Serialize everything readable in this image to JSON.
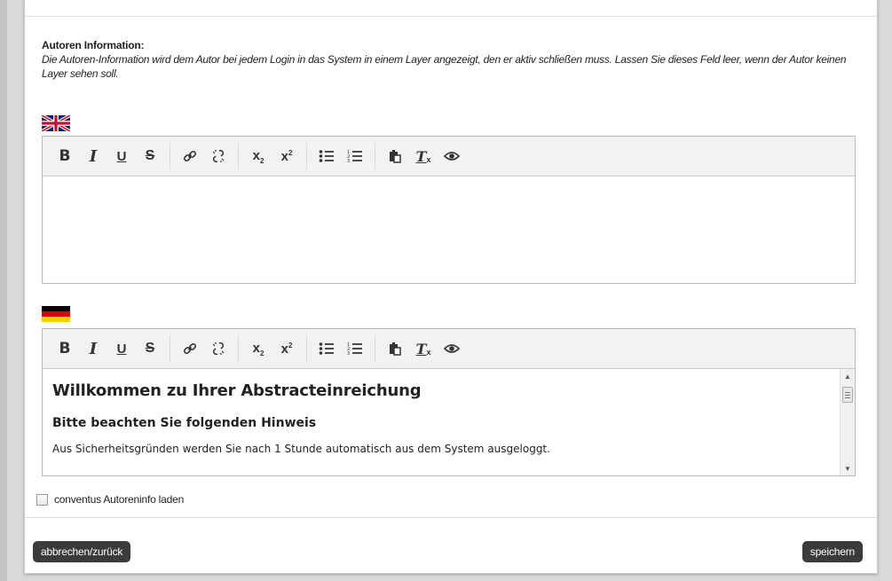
{
  "author_info": {
    "title": "Autoren Information:",
    "description": "Die Autoren-Information wird dem Autor bei jedem Login in das System in einem Layer angezeigt, den er aktiv schließen muss. Lassen Sie dieses Feld leer, wenn der Autor keinen Layer sehen soll."
  },
  "toolbar": {
    "buttons": [
      {
        "name": "bold",
        "icon": "bold-icon"
      },
      {
        "name": "italic",
        "icon": "italic-icon"
      },
      {
        "name": "underline",
        "icon": "underline-icon"
      },
      {
        "name": "strikethrough",
        "icon": "strikethrough-icon"
      },
      {
        "name": "link",
        "icon": "link-icon"
      },
      {
        "name": "unlink",
        "icon": "unlink-icon"
      },
      {
        "name": "subscript",
        "icon": "subscript-icon"
      },
      {
        "name": "superscript",
        "icon": "superscript-icon"
      },
      {
        "name": "bulleted-list",
        "icon": "bulleted-list-icon"
      },
      {
        "name": "numbered-list",
        "icon": "numbered-list-icon"
      },
      {
        "name": "paste",
        "icon": "paste-icon"
      },
      {
        "name": "remove-format",
        "icon": "remove-format-icon"
      },
      {
        "name": "preview",
        "icon": "eye-icon"
      }
    ]
  },
  "editor_en": {
    "flag": "uk-flag-icon",
    "content": ""
  },
  "editor_de": {
    "flag": "german-flag-icon",
    "heading": "Willkommen zu Ihrer Abstracteinreichung",
    "subheading": "Bitte beachten Sie folgenden Hinweis",
    "paragraph": "Aus Sicherheitsgründen werden Sie nach 1 Stunde automatisch aus dem System ausgeloggt."
  },
  "checkbox": {
    "label": "conventus Autoreninfo laden",
    "checked": false
  },
  "buttons": {
    "cancel": "abbrechen/zurück",
    "save": "speichern"
  },
  "colors": {
    "button_bg": "#3b3b3b",
    "toolbar_bg": "#f2f2f2"
  }
}
